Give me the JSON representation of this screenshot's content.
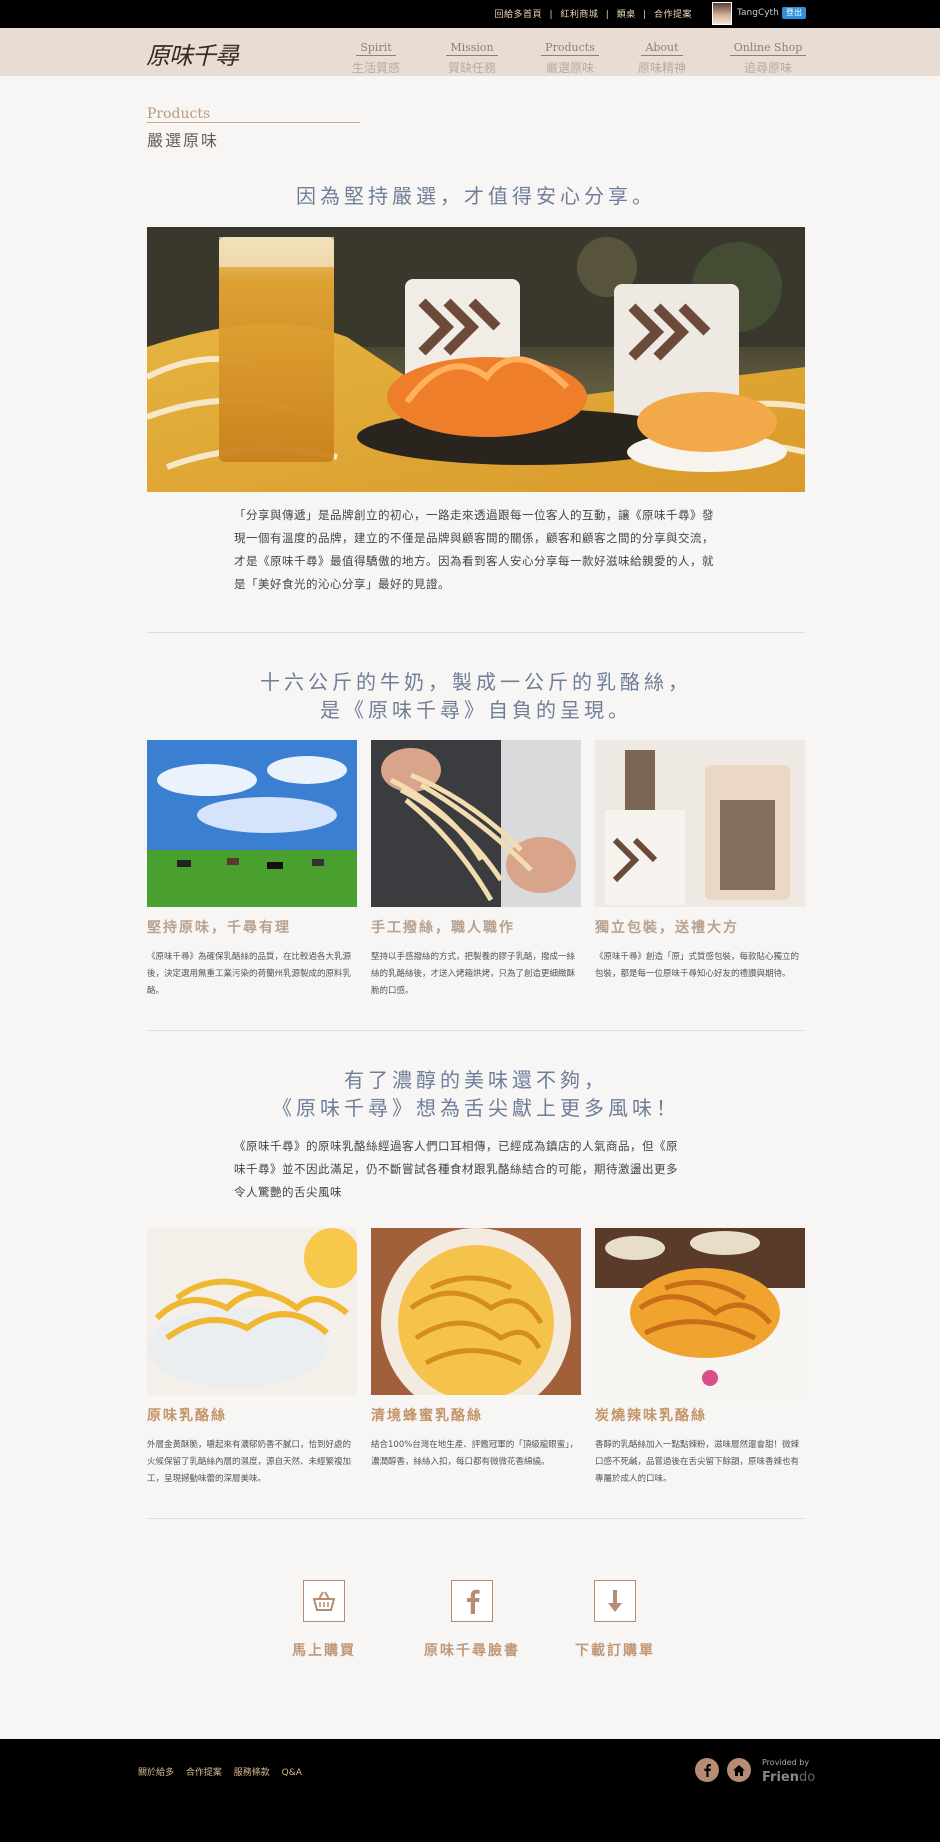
{
  "topbar": {
    "links": [
      "回給多首頁",
      "紅利商城",
      "類桌",
      "合作提案"
    ],
    "separator": "|",
    "user": "TangCyth",
    "logout": "登出"
  },
  "brand": {
    "logo": "原味千尋"
  },
  "nav": [
    {
      "en": "Spirit",
      "zh": "生活質感"
    },
    {
      "en": "Mission",
      "zh": "質缺任務"
    },
    {
      "en": "Products",
      "zh": "嚴選原味"
    },
    {
      "en": "About",
      "zh": "原味精神"
    },
    {
      "en": "Online Shop",
      "zh": "追尋原味"
    }
  ],
  "crumb": {
    "en": "Products",
    "zh": "嚴選原味"
  },
  "section1": {
    "headline": "因為堅持嚴選，才值得安心分享。",
    "paragraph": "「分享與傳遞」是品牌創立的初心，一路走來透過跟每一位客人的互動，讓《原味千尋》發現一個有溫度的品牌，建立的不僅是品牌與顧客間的關係，顧客和顧客之間的分享與交流，才是《原味千尋》最值得驕傲的地方。因為看到客人安心分享每一款好滋味給親愛的人，就是「美好食光的沁心分享」最好的見證。"
  },
  "section2": {
    "headline_line1": "十六公斤的牛奶，製成一公斤的乳酪絲，",
    "headline_line2": "是《原味千尋》自負的呈現。",
    "cards": [
      {
        "title": "堅持原味，千尋有理",
        "desc": "《原味千尋》為確保乳酪絲的品質，在比較過各大乳源後，決定選用無重工業污染的荷蘭州乳源製成的原料乳酪。"
      },
      {
        "title": "手工撥絲，職人職作",
        "desc": "堅持以手感撥絲的方式，把製養的膠子乳酪，撥成一絲絲的乳酪絲後，才送入烤箱烘烤，只為了創造更細緻酥脆的口感。"
      },
      {
        "title": "獨立包裝，送禮大方",
        "desc": "《原味千尋》創造「原」式質感包裝，每款貼心獨立的包裝，都是每一位原味千尋知心好友的禮讚與期待。"
      }
    ]
  },
  "section3": {
    "headline_line1": "有了濃醇的美味還不夠，",
    "headline_line2": "《原味千尋》想為舌尖獻上更多風味！",
    "paragraph": "《原味千尋》的原味乳酪絲經過客人們口耳相傳，已經成為鎮店的人氣商品，但《原味千尋》並不因此滿足，仍不斷嘗試各種食材跟乳酪絲結合的可能，期待激盪出更多令人驚艷的舌尖風味",
    "cards": [
      {
        "title": "原味乳酪絲",
        "desc": "外層金黃酥脆，嚼起來有濃郁奶香不膩口，恰到好處的火候保留了乳酪絲內層的濕度，源自天然、未經繁複加工，呈現撼動味蕾的深層美味。"
      },
      {
        "title": "清境蜂蜜乳酪絲",
        "desc": "結合100%台灣在地生產、評鑑冠軍的「頂級龍眼蜜」，濃潤醇香，絲絲入扣，每口都有微微花香綿繞。"
      },
      {
        "title": "炭燒辣味乳酪絲",
        "desc": "香醇的乳酪絲加入一點點辣粉，滋味層然還會甜！微辣口感不死鹹，品嘗過後在舌尖留下餘韻，原味香辣也有專屬於成人的口味。"
      }
    ]
  },
  "actions": [
    {
      "label": "馬上購買",
      "icon": "basket-icon"
    },
    {
      "label": "原味千尋臉書",
      "icon": "facebook-icon"
    },
    {
      "label": "下載訂購單",
      "icon": "download-icon"
    }
  ],
  "footer": {
    "links": [
      "關於給多",
      "合作提案",
      "服務條款",
      "Q&A"
    ],
    "provided_by": "Provided by",
    "provider_a": "Frien",
    "provider_b": "do"
  },
  "colors": {
    "heading": "#6f7e99",
    "accent": "#c4956a",
    "nav_bg": "#e7ddd5",
    "topbar_bg": "#000000"
  }
}
